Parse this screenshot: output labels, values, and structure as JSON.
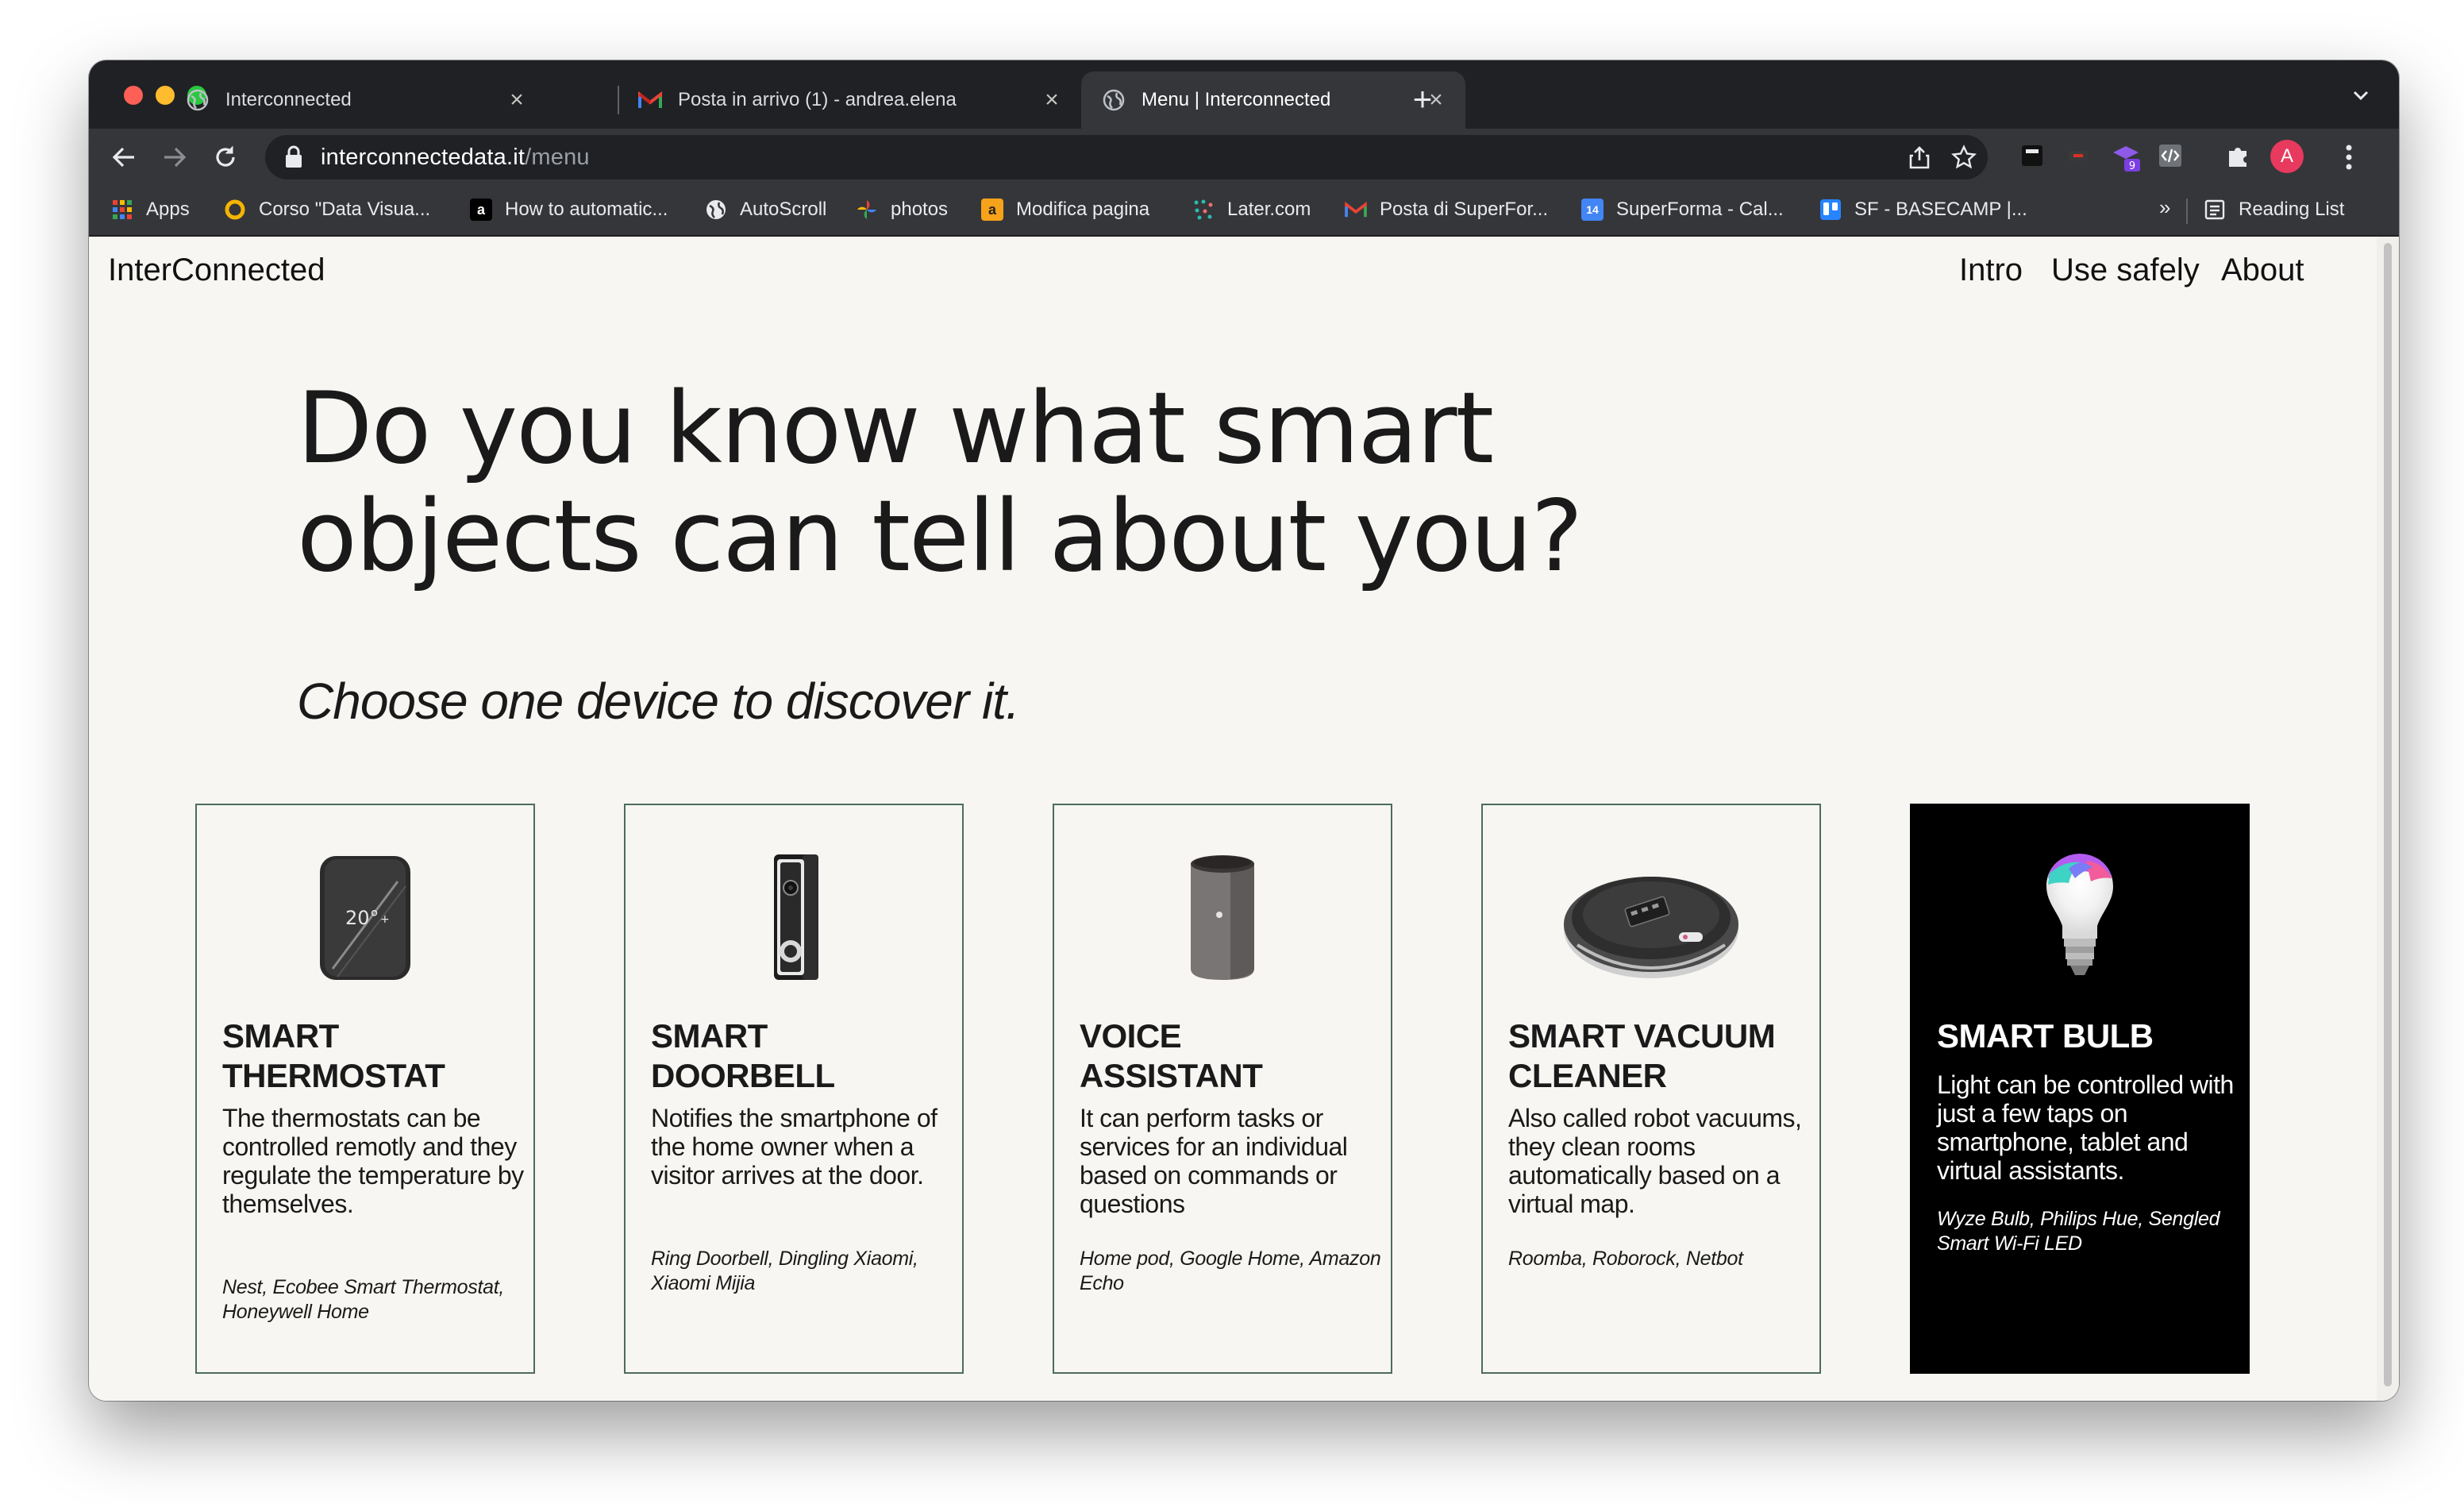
{
  "browser": {
    "tabs": [
      {
        "title": "Interconnected",
        "active": false,
        "favicon": "globe-icon"
      },
      {
        "title": "Posta in arrivo (1) - andrea.elena",
        "active": false,
        "favicon": "gmail-icon"
      },
      {
        "title": "Menu | Interconnected",
        "active": true,
        "favicon": "globe-icon"
      }
    ],
    "url_host": "interconnectedata.it",
    "url_path": "/menu",
    "avatar_initial": "A",
    "extension_badge": "9",
    "bookmarks": [
      {
        "label": "Apps",
        "icon": "apps-grid-icon"
      },
      {
        "label": "Corso \"Data Visua...",
        "icon": "ring-icon"
      },
      {
        "label": "How to automatic...",
        "icon": "a-logo-icon"
      },
      {
        "label": "AutoScroll",
        "icon": "globe-icon"
      },
      {
        "label": "photos",
        "icon": "pinwheel-icon"
      },
      {
        "label": "Modifica pagina",
        "icon": "a-orange-icon"
      },
      {
        "label": "Later.com",
        "icon": "later-icon"
      },
      {
        "label": "Posta di SuperFor...",
        "icon": "gmail-icon"
      },
      {
        "label": "SuperForma - Cal...",
        "icon": "calendar-icon"
      },
      {
        "label": "SF - BASECAMP |...",
        "icon": "trello-icon"
      }
    ],
    "bookmarks_more": "»",
    "reading_list": "Reading List"
  },
  "site": {
    "logo": "InterConnected",
    "nav": [
      "Intro",
      "Use safely",
      "About"
    ],
    "hero_title_line1": "Do you know what smart",
    "hero_title_line2": "objects can tell about you?",
    "hero_subtitle": "Choose one device to discover it.",
    "cards": [
      {
        "title_line1": "SMART",
        "title_line2": "THERMOSTAT",
        "description": "The thermostats can be controlled remotly and they regulate the temperature by themselves.",
        "brands": "Nest, Ecobee Smart Thermostat, Honeywell Home",
        "device_icon": "thermostat-icon",
        "device_readout": "20°"
      },
      {
        "title_line1": "SMART",
        "title_line2": "DOORBELL",
        "description": "Notifies the smartphone of the home owner when a visitor arrives at the door.",
        "brands": "Ring Doorbell, Dingling Xiaomi, Xiaomi Mijia",
        "device_icon": "doorbell-icon"
      },
      {
        "title_line1": "VOICE",
        "title_line2": "ASSISTANT",
        "description": "It can perform tasks or services for an individual based on commands or questions",
        "brands": "Home pod, Google Home, Amazon Echo",
        "device_icon": "smart-speaker-icon"
      },
      {
        "title_line1": "SMART VACUUM",
        "title_line2": "CLEANER",
        "description": "Also called robot vacuums, they clean rooms automatically based on a virtual map.",
        "brands": "Roomba, Roborock, Netbot",
        "device_icon": "robot-vacuum-icon"
      },
      {
        "title_line1": "SMART BULB",
        "title_line2": "",
        "description": "Light can be controlled with just a few taps on smartphone, tablet and virtual assistants.",
        "brands": "Wyze Bulb, Philips Hue, Sengled Smart Wi-Fi LED",
        "device_icon": "smart-bulb-icon",
        "highlighted": true
      }
    ]
  },
  "colors": {
    "page_background": "#f7f6f2",
    "card_border": "#4d6b62",
    "highlight_card": "#000000",
    "browser_frame": "#202124",
    "toolbar": "#35363a"
  }
}
